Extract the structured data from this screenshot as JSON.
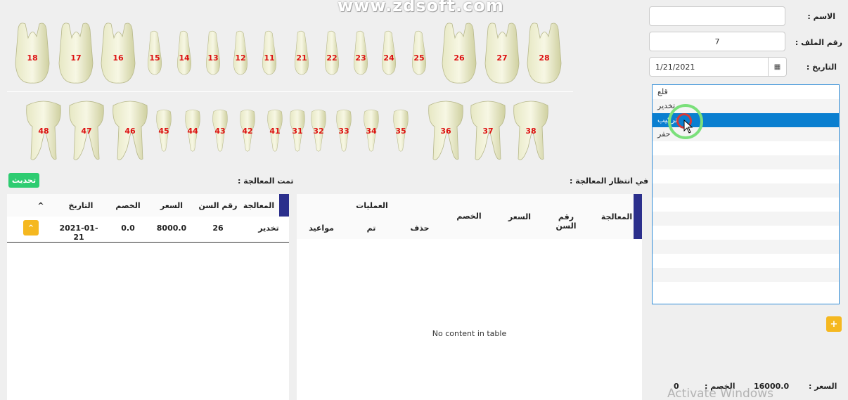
{
  "watermark": "www.zdsoft.com",
  "teeth": {
    "upper": [
      "18",
      "17",
      "16",
      "15",
      "14",
      "13",
      "12",
      "11",
      "21",
      "22",
      "23",
      "24",
      "25",
      "26",
      "27",
      "28"
    ],
    "lower": [
      "48",
      "47",
      "46",
      "45",
      "44",
      "43",
      "42",
      "41",
      "31",
      "32",
      "33",
      "34",
      "35",
      "36",
      "37",
      "38"
    ]
  },
  "form": {
    "name_label": "الاسم :",
    "name_value": "",
    "file_label": "رقم الملف :",
    "file_value": "7",
    "date_label": "التاريخ :",
    "date_value": "1/21/2021",
    "calendar_icon": "calendar-icon"
  },
  "treatments_list": {
    "items": [
      "قلع",
      "تخدير",
      "تركيب",
      "حفر"
    ],
    "selected": "تركيب"
  },
  "plus_button": "+",
  "done_section": {
    "title": "تمت المعالجة :",
    "update_button": "تحديث",
    "columns": [
      "المعالجة",
      "رقم السن",
      "السعر",
      "الخصم",
      "التاريخ",
      "^"
    ],
    "rows": [
      {
        "treatment": "تخدير",
        "tooth": "26",
        "price": "8000.0",
        "discount": "0.0",
        "date": "2021-01-21",
        "action": "^"
      }
    ]
  },
  "pending_section": {
    "title": "في انتظار المعالجة :",
    "columns": {
      "treatment": "المعالجة",
      "tooth": "رقم السن",
      "price": "السعر",
      "discount": "الخصم",
      "operations": "العمليات",
      "delete": "حذف",
      "done": "تم",
      "appointments": "مواعيد"
    },
    "empty_text": "No content in table"
  },
  "footer": {
    "price_label": "السعر :",
    "price_value": "16000.0",
    "discount_label": "الخصم :",
    "discount_value": "0"
  },
  "activate_windows": "Activate Windows",
  "colors": {
    "accent_blue": "#0a7fd0",
    "navy": "#2b2f8c",
    "green_button": "#2ecc71",
    "yellow_button": "#f5b820",
    "tooth_number": "#d11111"
  }
}
